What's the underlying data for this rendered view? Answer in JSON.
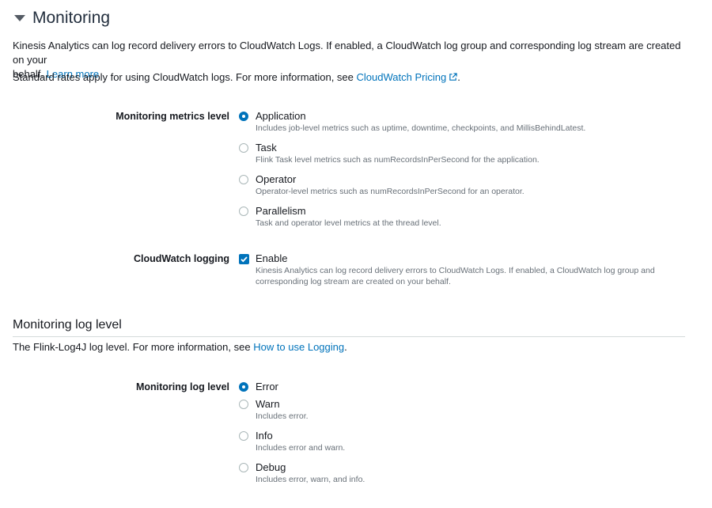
{
  "monitoring": {
    "title": "Monitoring",
    "description": "Kinesis Analytics can log record delivery errors to CloudWatch Logs. If enabled, a CloudWatch log group and corresponding log stream are created on your",
    "description_cont": "behalf.",
    "learn_more": "Learn more",
    "rates_text": "Standard rates apply for using CloudWatch logs. For more information, see",
    "rates_link": "CloudWatch Pricing",
    "rates_end": "."
  },
  "metrics_level": {
    "label": "Monitoring metrics level",
    "selected": "Application",
    "options": [
      {
        "label": "Application",
        "desc": "Includes job-level metrics such as uptime, downtime, checkpoints, and MillisBehindLatest."
      },
      {
        "label": "Task",
        "desc": "Flink Task level metrics such as numRecordsInPerSecond for the application."
      },
      {
        "label": "Operator",
        "desc": "Operator-level metrics such as numRecordsInPerSecond for an operator."
      },
      {
        "label": "Parallelism",
        "desc": "Task and operator level metrics at the thread level."
      }
    ]
  },
  "cloudwatch_logging": {
    "label": "CloudWatch logging",
    "checked": true,
    "option_label": "Enable",
    "desc_line1": "Kinesis Analytics can log record delivery errors to CloudWatch Logs. If enabled, a CloudWatch log group and",
    "desc_line2": "corresponding log stream are created on your behalf."
  },
  "log_level_section": {
    "title": "Monitoring log level",
    "text": "The Flink-Log4J log level. For more information, see",
    "link": "How to use Logging",
    "text_end": "."
  },
  "log_level": {
    "label": "Monitoring log level",
    "selected": "Error",
    "options": [
      {
        "label": "Error",
        "desc": ""
      },
      {
        "label": "Warn",
        "desc": "Includes error."
      },
      {
        "label": "Info",
        "desc": "Includes error and warn."
      },
      {
        "label": "Debug",
        "desc": "Includes error, warn, and info."
      }
    ]
  },
  "colors": {
    "accent": "#0073bb",
    "text": "#16191f",
    "muted": "#687078"
  },
  "icons": {
    "section_toggle": "caret-down-icon",
    "external_link": "external-link-icon"
  }
}
